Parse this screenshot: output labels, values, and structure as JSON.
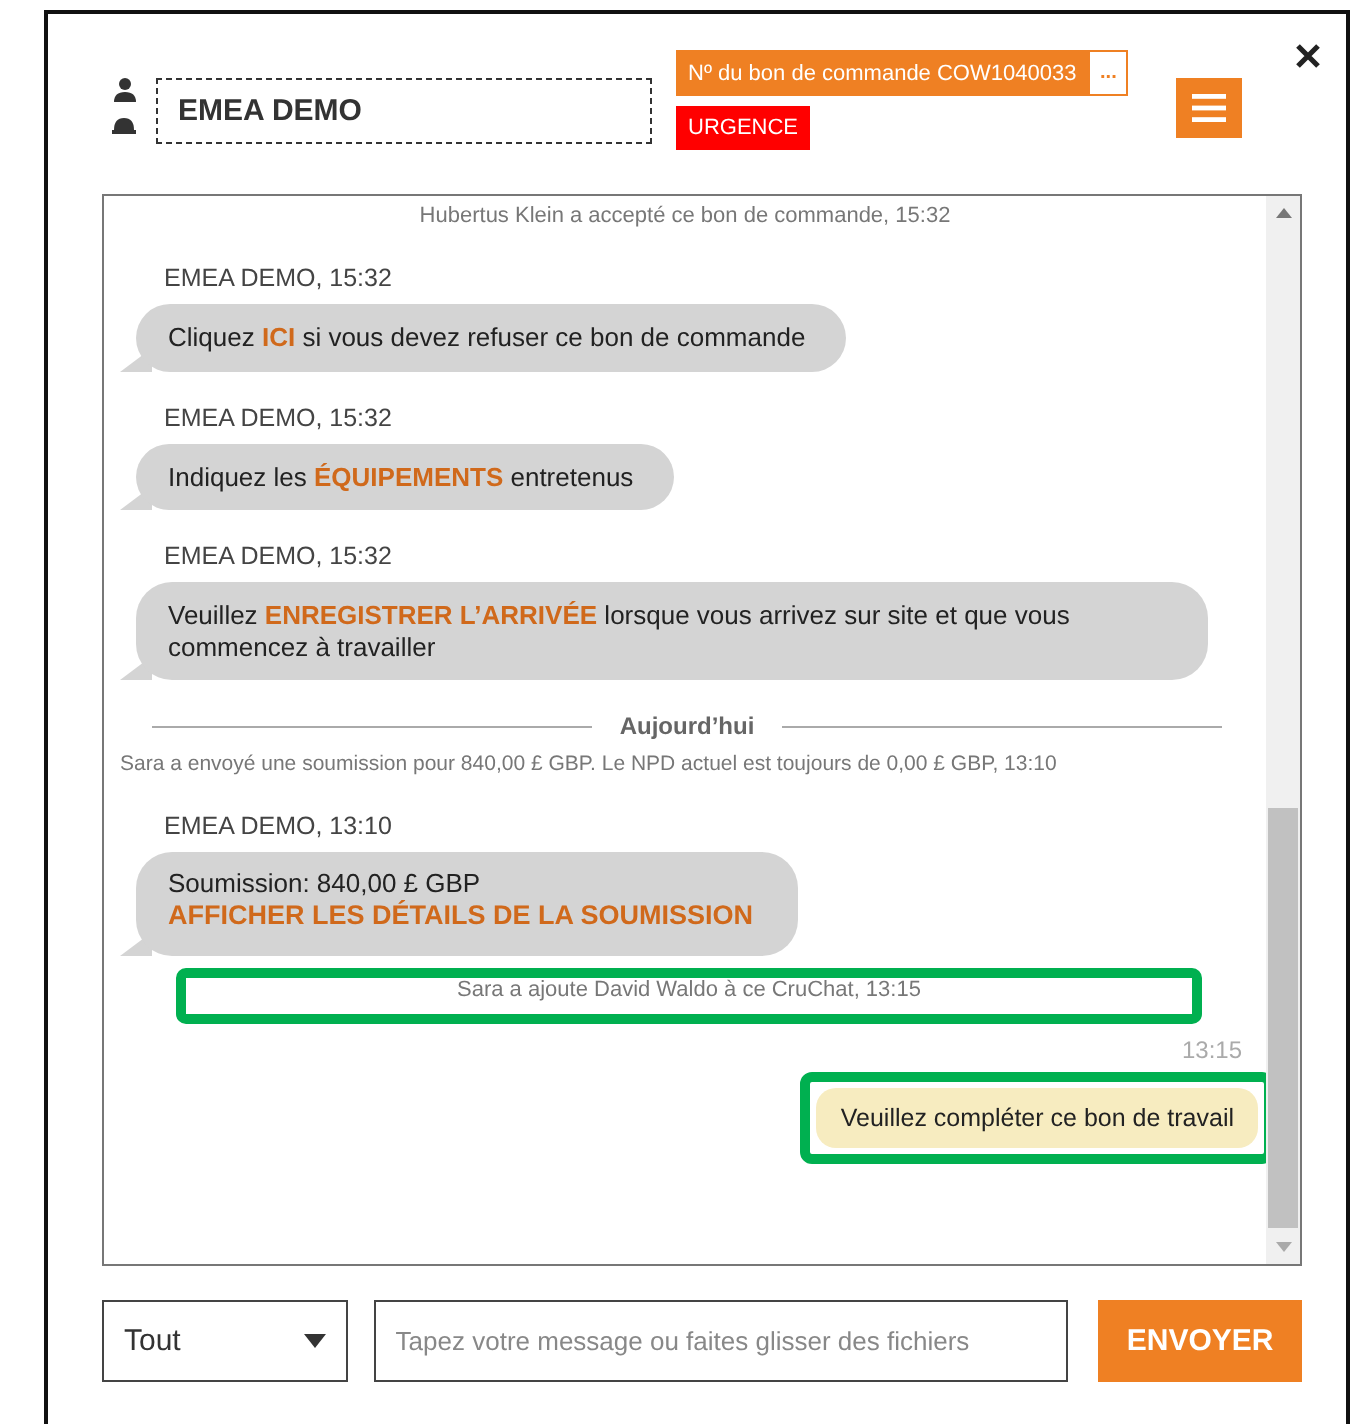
{
  "header": {
    "name_field": "EMEA DEMO",
    "order_tag": "Nº du bon de commande COW1040033",
    "order_more": "...",
    "priority_tag": "URGENCE"
  },
  "messages": [
    {
      "kind": "system",
      "text": "Hubertus Klein a accepté ce bon de commande, 15:32",
      "highlighted": false
    },
    {
      "kind": "incoming",
      "sender": "EMEA DEMO, 15:32",
      "text": "Cliquez **ICI** si vous devez refuser ce bon de commande"
    },
    {
      "kind": "incoming",
      "sender": "EMEA DEMO, 15:32",
      "text": "Indiquez les **ÉQUIPEMENTS** entretenus"
    },
    {
      "kind": "incoming",
      "sender": "EMEA DEMO, 15:32",
      "text": "Veuillez **ENREGISTRER L’ARRIVÉE** lorsque vous arrivez sur site et que vous commencez à travailler"
    },
    {
      "kind": "divider",
      "text": "Aujourd’hui"
    },
    {
      "kind": "system",
      "text": "Sara  a envoyé une soumission pour 840,00 £ GBP. Le NPD actuel est toujours de 0,00 £ GBP, 13:10",
      "highlighted": false
    },
    {
      "kind": "quote",
      "sender": "EMEA DEMO, 13:10",
      "text": "Soumission: 840,00 £ GBP",
      "link": "AFFICHER LES DÉTAILS DE LA SOUMISSION"
    },
    {
      "kind": "system",
      "text": "Sara a ajoute David Waldo à ce CruChat, 13:15",
      "highlighted": true
    },
    {
      "kind": "outgoing",
      "time": "13:15",
      "text": "Veuillez compléter ce bon de travail",
      "highlighted": true
    }
  ],
  "composer": {
    "filter": "Tout",
    "placeholder": "Tapez votre message ou faites glisser des fichiers",
    "send": "ENVOYER"
  }
}
